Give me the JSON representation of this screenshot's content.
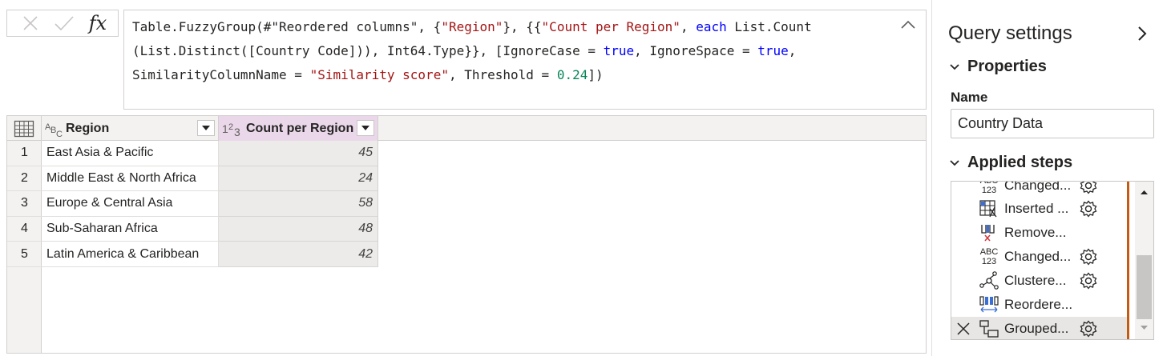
{
  "formula_bar": {
    "cancel_label": "×",
    "commit_label": "✓",
    "fx_label": "fx",
    "formula": "Table.FuzzyGroup(#\"Reordered columns\", {\"Region\"}, {{\"Count per Region\", each List.Count (List.Distinct([Country Code])), Int64.Type}}, [IgnoreCase = true, IgnoreSpace = true, SimilarityColumnName = \"Similarity score\", Threshold = 0.24])",
    "line1": {
      "a": "Table.FuzzyGroup(#\"Reordered columns\", {",
      "b": "\"Region\"",
      "c": "}, {{",
      "d": "\"Count per Region\"",
      "e": ", ",
      "f": "each",
      "g": " List.Count"
    },
    "line2": {
      "a": "(List.Distinct([Country Code])), Int64.Type}}, [IgnoreCase = ",
      "b": "true",
      "c": ", IgnoreSpace = ",
      "d": "true",
      "e": ","
    },
    "line3": {
      "a": "SimilarityColumnName = ",
      "b": "\"Similarity score\"",
      "c": ", Threshold = ",
      "d": "0.24",
      "e": "])"
    }
  },
  "grid": {
    "columns": [
      {
        "name": "Region",
        "type": "text"
      },
      {
        "name": "Count per Region",
        "type": "number"
      }
    ],
    "type_icons": {
      "text": "ABC",
      "number": "123"
    },
    "rows": [
      {
        "num": "1",
        "region": "East Asia & Pacific",
        "count": "45"
      },
      {
        "num": "2",
        "region": "Middle East & North Africa",
        "count": "24"
      },
      {
        "num": "3",
        "region": "Europe & Central Asia",
        "count": "58"
      },
      {
        "num": "4",
        "region": "Sub-Saharan Africa",
        "count": "48"
      },
      {
        "num": "5",
        "region": "Latin America & Caribbean",
        "count": "42"
      }
    ]
  },
  "query_settings": {
    "title": "Query settings",
    "properties_label": "Properties",
    "name_label": "Name",
    "name_value": "Country Data",
    "applied_steps_label": "Applied steps",
    "steps": [
      {
        "label": "Changed...",
        "icon": "abc123-icon",
        "has_gear": true
      },
      {
        "label": "Inserted ...",
        "icon": "insert-column-icon",
        "has_gear": true
      },
      {
        "label": "Remove...",
        "icon": "remove-columns-icon",
        "has_gear": false
      },
      {
        "label": "Changed...",
        "icon": "abc123-icon",
        "has_gear": true
      },
      {
        "label": "Clustere...",
        "icon": "cluster-icon",
        "has_gear": true
      },
      {
        "label": "Reordere...",
        "icon": "reorder-columns-icon",
        "has_gear": false
      },
      {
        "label": "Grouped...",
        "icon": "group-by-icon",
        "has_gear": true,
        "selected": true
      }
    ]
  },
  "colors": {
    "count_header_bg": "#ead8ea",
    "keyword": "#0000ff",
    "string": "#a31515",
    "number": "#098658",
    "step_bar": "#c55a11"
  }
}
